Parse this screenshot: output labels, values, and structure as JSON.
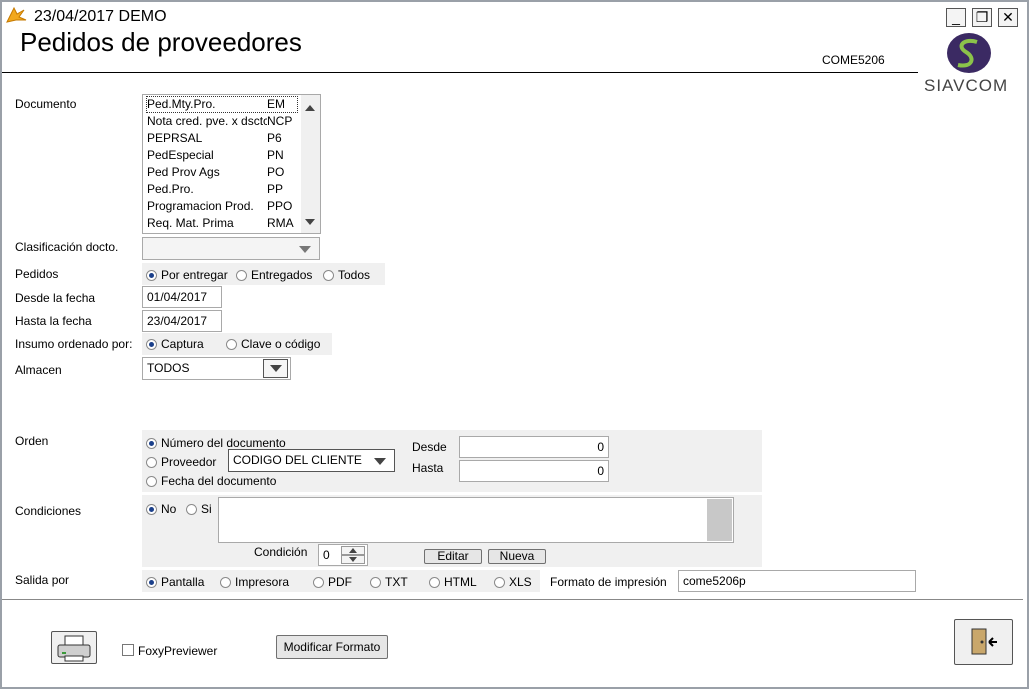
{
  "window": {
    "title": "23/04/2017  DEMO",
    "minimize": "_",
    "restore": "❐",
    "close": "✕"
  },
  "page": {
    "heading": "Pedidos de proveedores",
    "code": "COME5206",
    "logo_text": "SIAVCOM"
  },
  "documento": {
    "label": "Documento",
    "items": [
      {
        "name": "Ped.Mty.Pro.",
        "code": "EM"
      },
      {
        "name": "Nota cred. pve. x dsctc",
        "code": "NCP"
      },
      {
        "name": "PEPRSAL",
        "code": "P6"
      },
      {
        "name": "PedEspecial",
        "code": "PN"
      },
      {
        "name": "Ped Prov Ags",
        "code": "PO"
      },
      {
        "name": "Ped.Pro.",
        "code": "PP"
      },
      {
        "name": "Programacion Prod.",
        "code": "PPO"
      },
      {
        "name": "Req. Mat. Prima",
        "code": "RMA"
      }
    ]
  },
  "clasificacion": {
    "label": "Clasificación docto.",
    "value": ""
  },
  "pedidos": {
    "label": "Pedidos",
    "options": [
      "Por entregar",
      "Entregados",
      "Todos"
    ],
    "selected": 0
  },
  "desde_fecha": {
    "label": "Desde la fecha",
    "value": "01/04/2017"
  },
  "hasta_fecha": {
    "label": "Hasta la fecha",
    "value": "23/04/2017"
  },
  "insumo": {
    "label": "Insumo ordenado por:",
    "options": [
      "Captura",
      "Clave o código"
    ],
    "selected": 0
  },
  "almacen": {
    "label": "Almacen",
    "value": "TODOS"
  },
  "orden": {
    "label": "Orden",
    "options": [
      "Número del documento",
      "Proveedor",
      "Fecha del documento"
    ],
    "selected": 0,
    "proveedor_combo": "CODIGO DEL CLIENTE O",
    "desde_label": "Desde",
    "desde_value": "0",
    "hasta_label": "Hasta",
    "hasta_value": "0"
  },
  "condiciones": {
    "label": "Condiciones",
    "options": [
      "No",
      "Si"
    ],
    "selected": 0,
    "condicion_label": "Condición",
    "condicion_value": "0",
    "editar_label": "Editar",
    "nueva_label": "Nueva"
  },
  "salida": {
    "label": "Salida por",
    "options": [
      "Pantalla",
      "Impresora",
      "PDF",
      "TXT",
      "HTML",
      "XLS"
    ],
    "selected": 0,
    "formato_label": "Formato de impresión",
    "formato_value": "come5206p"
  },
  "footer": {
    "foxy_label": "FoxyPreviewer",
    "foxy_checked": false,
    "modificar_label": "Modificar Formato"
  }
}
